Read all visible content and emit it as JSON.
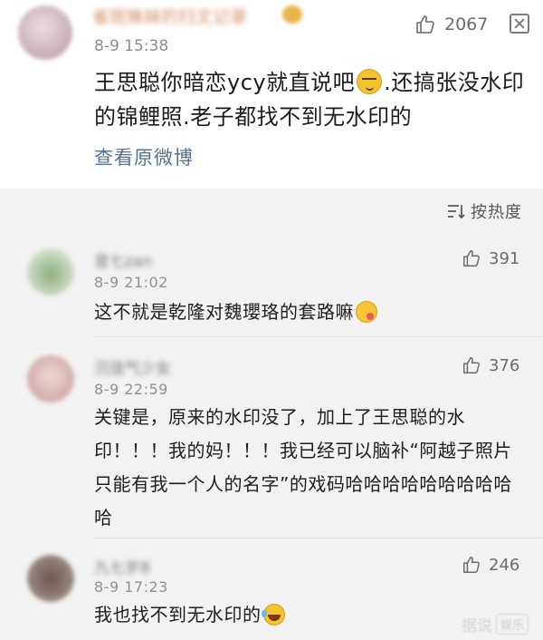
{
  "main_post": {
    "author": "雀斑姝妹的扫文记录",
    "time": "8-9 15:38",
    "likes": "2067",
    "text_part1": "王思聪你暗恋ycy就直说吧",
    "text_part2": ".还搞张没水印的锦鲤照.老子都找不到无水印的",
    "view_original": "查看原微博"
  },
  "sort": {
    "label": "按热度"
  },
  "comments": [
    {
      "user": "昔七zan",
      "time": "8-9 21:02",
      "likes": "391",
      "text": "这不就是乾隆对魏瓔珞的套路嘛",
      "emoji": "yum-face-icon"
    },
    {
      "user": "沉佳气少女",
      "time": "8-9 22:59",
      "likes": "376",
      "text": "关键是，原来的水印没了，加上了王思聪的水印！！！我的妈！！！我已经可以脑补“阿越子照片只能有我一个人的名字”的戏码哈哈哈哈哈哈哈哈哈哈"
    },
    {
      "user": "九七岁8",
      "time": "8-9 17:23",
      "likes": "246",
      "text": "我也找不到无水印的",
      "emoji": "laugh-cry-icon"
    }
  ],
  "watermark": {
    "text": "据说",
    "badge": "娱乐"
  },
  "colors": {
    "link": "#56708f",
    "author_name": "#d48c62",
    "background": "#f2f2f2"
  }
}
